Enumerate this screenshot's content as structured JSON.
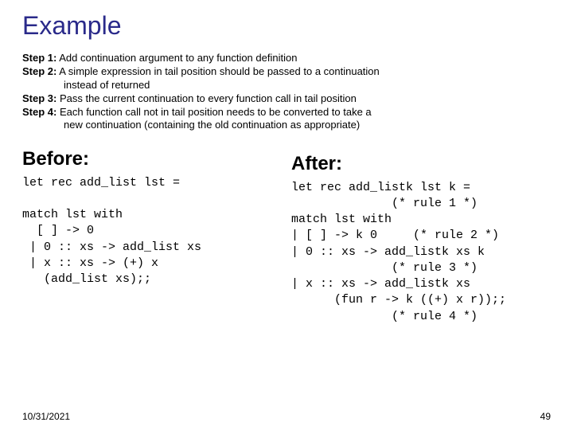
{
  "title": "Example",
  "steps": [
    {
      "label": "Step 1:",
      "text": " Add continuation argument to any function definition",
      "cont": ""
    },
    {
      "label": "Step 2:",
      "text": " A simple expression in tail position should be passed to a continuation",
      "cont": "instead of returned"
    },
    {
      "label": "Step 3:",
      "text": " Pass the current continuation to every function call in tail position",
      "cont": ""
    },
    {
      "label": "Step 4:",
      "text": " Each function call not in tail position needs to be converted to take a",
      "cont": "new continuation (containing the old continuation as appropriate)"
    }
  ],
  "before": {
    "heading": "Before:",
    "code": "let rec add_list lst =\n\nmatch lst with\n  [ ] -> 0\n | 0 :: xs -> add_list xs\n | x :: xs -> (+) x\n   (add_list xs);;"
  },
  "after": {
    "heading": "After:",
    "code": "let rec add_listk lst k =\n              (* rule 1 *)\nmatch lst with\n| [ ] -> k 0     (* rule 2 *)\n| 0 :: xs -> add_listk xs k\n              (* rule 3 *)\n| x :: xs -> add_listk xs\n      (fun r -> k ((+) x r));;\n              (* rule 4 *)"
  },
  "footer": {
    "date": "10/31/2021",
    "page": "49"
  }
}
